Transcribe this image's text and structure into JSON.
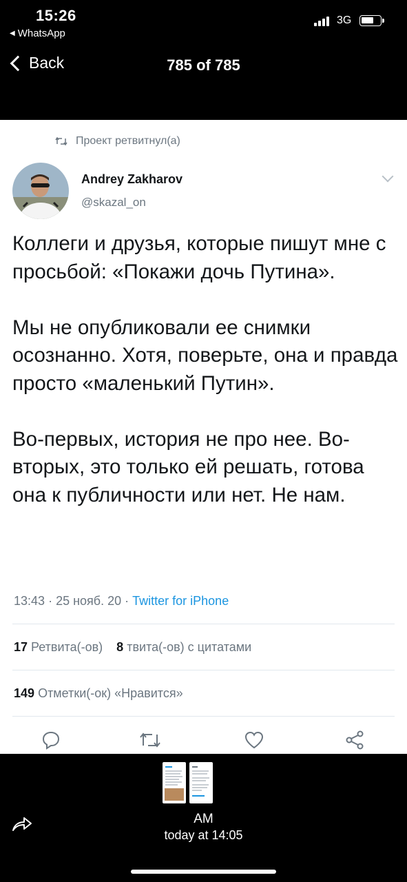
{
  "status_bar": {
    "time": "15:26",
    "back_app": "WhatsApp",
    "network": "3G",
    "battery_level": 0.65
  },
  "nav": {
    "back_label": "Back",
    "counter": "785 of 785"
  },
  "tweet": {
    "retweeted_by": "Проект ретвитнул(а)",
    "author_name": "Andrey Zakharov",
    "author_handle": "@skazal_on",
    "paragraphs": [
      "Коллеги и друзья, которые пишут мне с просьбой: «Покажи дочь Путина».",
      "Мы не опубликовали ее снимки осознанно. Хотя, поверьте, она и правда просто «маленький Путин».",
      "Во-первых, история не про нее. Во-вторых, это только ей решать, готова она к публичности или нет. Не нам."
    ],
    "time": "13:43",
    "date": "25 нояб. 20",
    "source": "Twitter for iPhone",
    "retweets_count": "17",
    "retweets_label": "Ретвита(-ов)",
    "quotes_count": "8",
    "quotes_label": "твита(-ов) с цитатами",
    "likes_count": "149",
    "likes_label": "Отметки(-ок) «Нравится»"
  },
  "bottom": {
    "sender": "AM",
    "sent_time": "today at 14:05"
  },
  "colors": {
    "background": "#000000",
    "card": "#ffffff",
    "text": "#14171a",
    "secondary_text": "#6b7680",
    "link": "#1b95e0"
  },
  "icons": [
    "reply-icon",
    "retweet-icon",
    "like-icon",
    "share-icon",
    "forward-icon",
    "chevron-down-icon",
    "signal-icon",
    "battery-icon"
  ]
}
